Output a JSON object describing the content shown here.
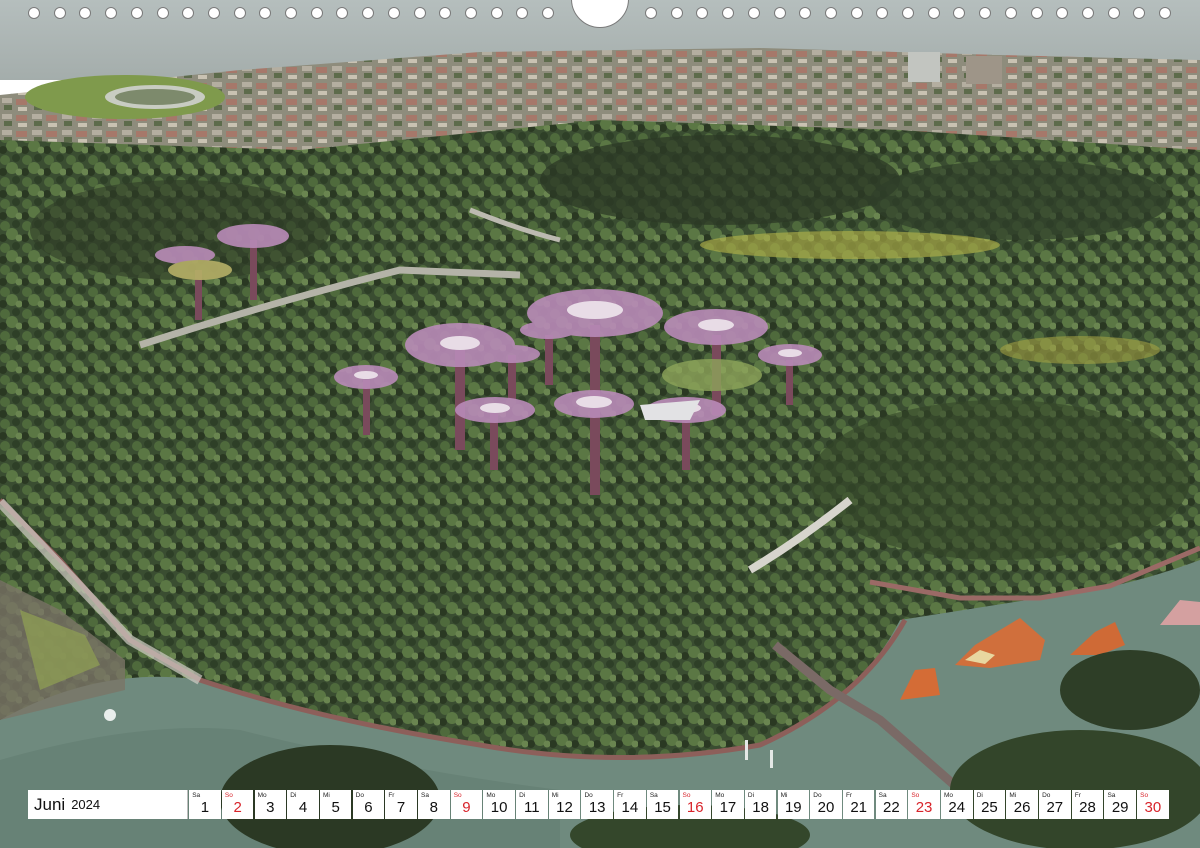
{
  "calendar": {
    "month": "Juni",
    "year": "2024",
    "days": [
      {
        "num": "1",
        "wd": "Sa"
      },
      {
        "num": "2",
        "wd": "So",
        "sun": true
      },
      {
        "num": "3",
        "wd": "Mo"
      },
      {
        "num": "4",
        "wd": "Di"
      },
      {
        "num": "5",
        "wd": "Mi"
      },
      {
        "num": "6",
        "wd": "Do"
      },
      {
        "num": "7",
        "wd": "Fr"
      },
      {
        "num": "8",
        "wd": "Sa"
      },
      {
        "num": "9",
        "wd": "So",
        "sun": true
      },
      {
        "num": "10",
        "wd": "Mo"
      },
      {
        "num": "11",
        "wd": "Di"
      },
      {
        "num": "12",
        "wd": "Mi"
      },
      {
        "num": "13",
        "wd": "Do"
      },
      {
        "num": "14",
        "wd": "Fr"
      },
      {
        "num": "15",
        "wd": "Sa"
      },
      {
        "num": "16",
        "wd": "So",
        "sun": true
      },
      {
        "num": "17",
        "wd": "Mo"
      },
      {
        "num": "18",
        "wd": "Di"
      },
      {
        "num": "19",
        "wd": "Mi"
      },
      {
        "num": "20",
        "wd": "Do"
      },
      {
        "num": "21",
        "wd": "Fr"
      },
      {
        "num": "22",
        "wd": "Sa"
      },
      {
        "num": "23",
        "wd": "So",
        "sun": true
      },
      {
        "num": "24",
        "wd": "Mo"
      },
      {
        "num": "25",
        "wd": "Di"
      },
      {
        "num": "26",
        "wd": "Mi"
      },
      {
        "num": "27",
        "wd": "Do"
      },
      {
        "num": "28",
        "wd": "Fr"
      },
      {
        "num": "29",
        "wd": "Sa"
      },
      {
        "num": "30",
        "wd": "So",
        "sun": true
      }
    ]
  },
  "colors": {
    "sunday": "#d8232a",
    "sea": "#b9c2c0",
    "pond": "#6f8a7e",
    "forest": "#3c4f33",
    "supertree": "#b98bb8"
  }
}
